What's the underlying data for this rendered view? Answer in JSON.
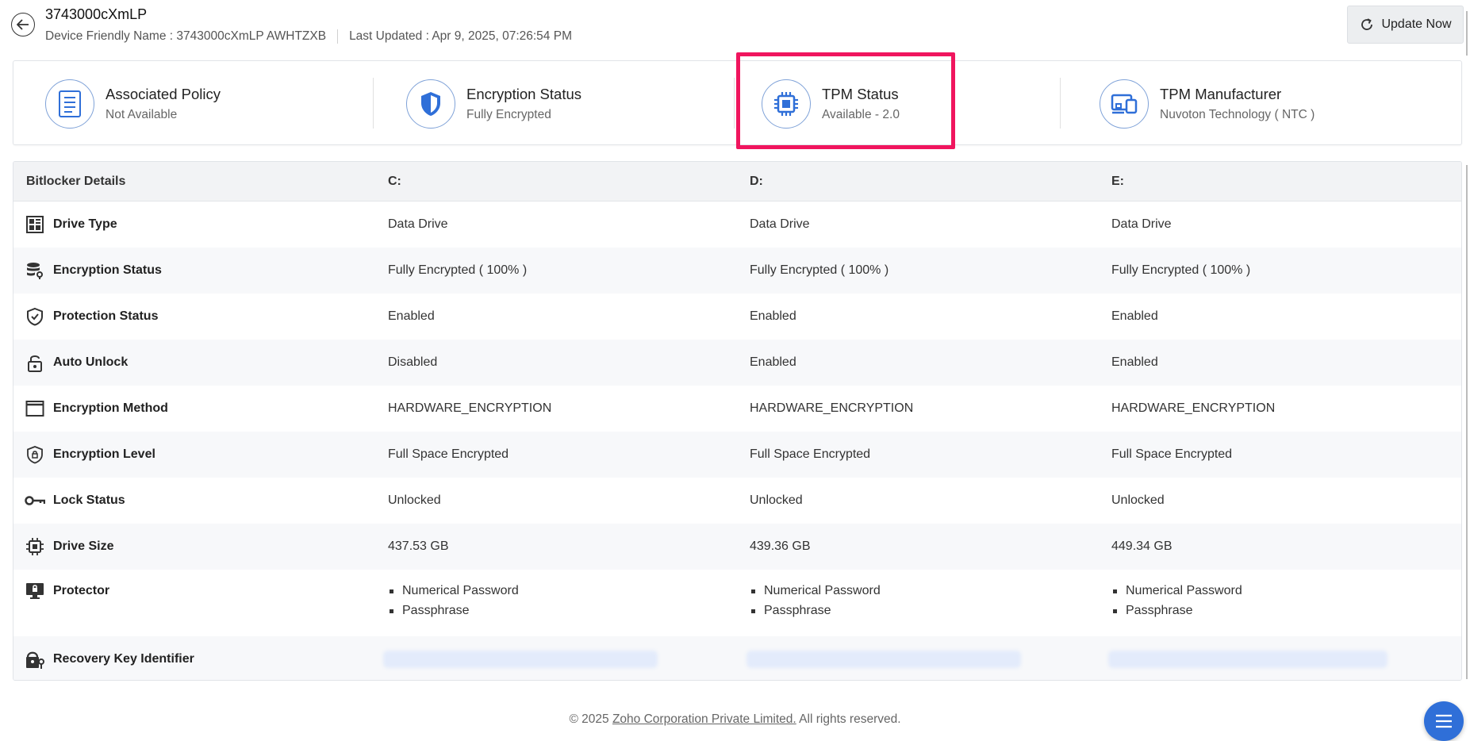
{
  "header": {
    "device_name": "3743000cXmLP",
    "friendly_name_text": "Device Friendly Name : 3743000cXmLP AWHTZXB",
    "last_updated_text": "Last Updated : Apr 9, 2025, 07:26:54 PM",
    "update_label": "Update Now"
  },
  "summary": [
    {
      "title": "Associated Policy",
      "value": "Not Available",
      "icon": "policy-document-icon"
    },
    {
      "title": "Encryption Status",
      "value": "Fully Encrypted",
      "icon": "shield-icon"
    },
    {
      "title": "TPM Status",
      "value": "Available - 2.0",
      "icon": "chip-icon"
    },
    {
      "title": "TPM Manufacturer",
      "value": "Nuvoton Technology ( NTC )",
      "icon": "devices-icon"
    }
  ],
  "table": {
    "headers": [
      "Bitlocker Details",
      "C:",
      "D:",
      "E:"
    ],
    "rows": [
      {
        "label": "Drive Type",
        "icon": "drive-type-icon",
        "values": [
          "Data Drive",
          "Data Drive",
          "Data Drive"
        ]
      },
      {
        "label": "Encryption Status",
        "icon": "database-key-icon",
        "values": [
          "Fully Encrypted ( 100% )",
          "Fully Encrypted ( 100% )",
          "Fully Encrypted ( 100% )"
        ]
      },
      {
        "label": "Protection Status",
        "icon": "shield-check-icon",
        "values": [
          "Enabled",
          "Enabled",
          "Enabled"
        ]
      },
      {
        "label": "Auto Unlock",
        "icon": "unlock-icon",
        "values": [
          "Disabled",
          "Enabled",
          "Enabled"
        ]
      },
      {
        "label": "Encryption Method",
        "icon": "window-icon",
        "values": [
          "HARDWARE_ENCRYPTION",
          "HARDWARE_ENCRYPTION",
          "HARDWARE_ENCRYPTION"
        ]
      },
      {
        "label": "Encryption Level",
        "icon": "shield-lock-icon",
        "values": [
          "Full Space Encrypted",
          "Full Space Encrypted",
          "Full Space Encrypted"
        ]
      },
      {
        "label": "Lock Status",
        "icon": "key-icon",
        "values": [
          "Unlocked",
          "Unlocked",
          "Unlocked"
        ]
      },
      {
        "label": "Drive Size",
        "icon": "chip-icon",
        "values": [
          "437.53 GB",
          "439.36 GB",
          "449.34 GB"
        ]
      },
      {
        "label": "Protector",
        "icon": "monitor-lock-icon",
        "values": [
          [
            "Numerical Password",
            "Passphrase"
          ],
          [
            "Numerical Password",
            "Passphrase"
          ],
          [
            "Numerical Password",
            "Passphrase"
          ]
        ]
      },
      {
        "label": "Recovery Key Identifier",
        "icon": "recovery-key-icon",
        "values": [
          "",
          "",
          ""
        ]
      }
    ]
  },
  "footer": {
    "prefix": "© 2025 ",
    "link": "Zoho Corporation Private Limited.",
    "suffix": " All rights reserved."
  },
  "colors": {
    "accent": "#2f6fd8",
    "highlight": "#f0155e"
  }
}
